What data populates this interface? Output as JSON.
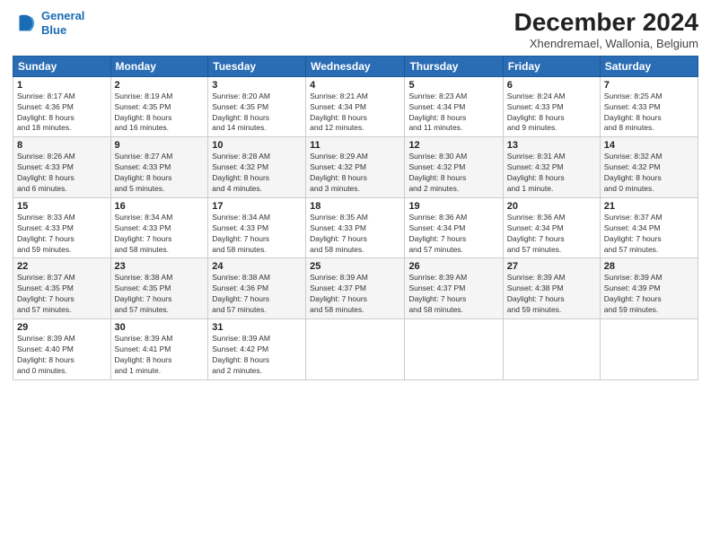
{
  "header": {
    "logo_line1": "General",
    "logo_line2": "Blue",
    "main_title": "December 2024",
    "subtitle": "Xhendremael, Wallonia, Belgium"
  },
  "weekdays": [
    "Sunday",
    "Monday",
    "Tuesday",
    "Wednesday",
    "Thursday",
    "Friday",
    "Saturday"
  ],
  "weeks": [
    [
      {
        "day": "1",
        "info": "Sunrise: 8:17 AM\nSunset: 4:36 PM\nDaylight: 8 hours\nand 18 minutes."
      },
      {
        "day": "2",
        "info": "Sunrise: 8:19 AM\nSunset: 4:35 PM\nDaylight: 8 hours\nand 16 minutes."
      },
      {
        "day": "3",
        "info": "Sunrise: 8:20 AM\nSunset: 4:35 PM\nDaylight: 8 hours\nand 14 minutes."
      },
      {
        "day": "4",
        "info": "Sunrise: 8:21 AM\nSunset: 4:34 PM\nDaylight: 8 hours\nand 12 minutes."
      },
      {
        "day": "5",
        "info": "Sunrise: 8:23 AM\nSunset: 4:34 PM\nDaylight: 8 hours\nand 11 minutes."
      },
      {
        "day": "6",
        "info": "Sunrise: 8:24 AM\nSunset: 4:33 PM\nDaylight: 8 hours\nand 9 minutes."
      },
      {
        "day": "7",
        "info": "Sunrise: 8:25 AM\nSunset: 4:33 PM\nDaylight: 8 hours\nand 8 minutes."
      }
    ],
    [
      {
        "day": "8",
        "info": "Sunrise: 8:26 AM\nSunset: 4:33 PM\nDaylight: 8 hours\nand 6 minutes."
      },
      {
        "day": "9",
        "info": "Sunrise: 8:27 AM\nSunset: 4:33 PM\nDaylight: 8 hours\nand 5 minutes."
      },
      {
        "day": "10",
        "info": "Sunrise: 8:28 AM\nSunset: 4:32 PM\nDaylight: 8 hours\nand 4 minutes."
      },
      {
        "day": "11",
        "info": "Sunrise: 8:29 AM\nSunset: 4:32 PM\nDaylight: 8 hours\nand 3 minutes."
      },
      {
        "day": "12",
        "info": "Sunrise: 8:30 AM\nSunset: 4:32 PM\nDaylight: 8 hours\nand 2 minutes."
      },
      {
        "day": "13",
        "info": "Sunrise: 8:31 AM\nSunset: 4:32 PM\nDaylight: 8 hours\nand 1 minute."
      },
      {
        "day": "14",
        "info": "Sunrise: 8:32 AM\nSunset: 4:32 PM\nDaylight: 8 hours\nand 0 minutes."
      }
    ],
    [
      {
        "day": "15",
        "info": "Sunrise: 8:33 AM\nSunset: 4:33 PM\nDaylight: 7 hours\nand 59 minutes."
      },
      {
        "day": "16",
        "info": "Sunrise: 8:34 AM\nSunset: 4:33 PM\nDaylight: 7 hours\nand 58 minutes."
      },
      {
        "day": "17",
        "info": "Sunrise: 8:34 AM\nSunset: 4:33 PM\nDaylight: 7 hours\nand 58 minutes."
      },
      {
        "day": "18",
        "info": "Sunrise: 8:35 AM\nSunset: 4:33 PM\nDaylight: 7 hours\nand 58 minutes."
      },
      {
        "day": "19",
        "info": "Sunrise: 8:36 AM\nSunset: 4:34 PM\nDaylight: 7 hours\nand 57 minutes."
      },
      {
        "day": "20",
        "info": "Sunrise: 8:36 AM\nSunset: 4:34 PM\nDaylight: 7 hours\nand 57 minutes."
      },
      {
        "day": "21",
        "info": "Sunrise: 8:37 AM\nSunset: 4:34 PM\nDaylight: 7 hours\nand 57 minutes."
      }
    ],
    [
      {
        "day": "22",
        "info": "Sunrise: 8:37 AM\nSunset: 4:35 PM\nDaylight: 7 hours\nand 57 minutes."
      },
      {
        "day": "23",
        "info": "Sunrise: 8:38 AM\nSunset: 4:35 PM\nDaylight: 7 hours\nand 57 minutes."
      },
      {
        "day": "24",
        "info": "Sunrise: 8:38 AM\nSunset: 4:36 PM\nDaylight: 7 hours\nand 57 minutes."
      },
      {
        "day": "25",
        "info": "Sunrise: 8:39 AM\nSunset: 4:37 PM\nDaylight: 7 hours\nand 58 minutes."
      },
      {
        "day": "26",
        "info": "Sunrise: 8:39 AM\nSunset: 4:37 PM\nDaylight: 7 hours\nand 58 minutes."
      },
      {
        "day": "27",
        "info": "Sunrise: 8:39 AM\nSunset: 4:38 PM\nDaylight: 7 hours\nand 59 minutes."
      },
      {
        "day": "28",
        "info": "Sunrise: 8:39 AM\nSunset: 4:39 PM\nDaylight: 7 hours\nand 59 minutes."
      }
    ],
    [
      {
        "day": "29",
        "info": "Sunrise: 8:39 AM\nSunset: 4:40 PM\nDaylight: 8 hours\nand 0 minutes."
      },
      {
        "day": "30",
        "info": "Sunrise: 8:39 AM\nSunset: 4:41 PM\nDaylight: 8 hours\nand 1 minute."
      },
      {
        "day": "31",
        "info": "Sunrise: 8:39 AM\nSunset: 4:42 PM\nDaylight: 8 hours\nand 2 minutes."
      },
      null,
      null,
      null,
      null
    ]
  ]
}
